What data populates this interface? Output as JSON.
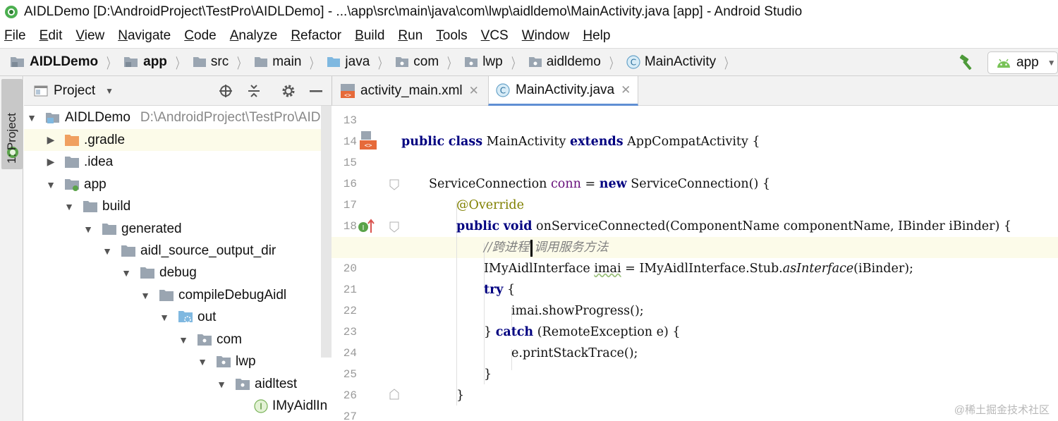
{
  "window": {
    "title": "AIDLDemo [D:\\AndroidProject\\TestPro\\AIDLDemo] - ...\\app\\src\\main\\java\\com\\lwp\\aidldemo\\MainActivity.java [app] - Android Studio"
  },
  "menu": [
    "File",
    "Edit",
    "View",
    "Navigate",
    "Code",
    "Analyze",
    "Refactor",
    "Build",
    "Run",
    "Tools",
    "VCS",
    "Window",
    "Help"
  ],
  "breadcrumb": [
    "AIDLDemo",
    "app",
    "src",
    "main",
    "java",
    "com",
    "lwp",
    "aidldemo",
    "MainActivity"
  ],
  "run_config": "app",
  "tool_window": {
    "label": "1: Project"
  },
  "project_panel": {
    "view": "Project",
    "tree": [
      {
        "label": "AIDLDemo",
        "path": "D:\\AndroidProject\\TestPro\\AIDL"
      },
      {
        "label": ".gradle"
      },
      {
        "label": ".idea"
      },
      {
        "label": "app"
      },
      {
        "label": "build"
      },
      {
        "label": "generated"
      },
      {
        "label": "aidl_source_output_dir"
      },
      {
        "label": "debug"
      },
      {
        "label": "compileDebugAidl"
      },
      {
        "label": "out"
      },
      {
        "label": "com"
      },
      {
        "label": "lwp"
      },
      {
        "label": "aidltest"
      },
      {
        "label": "IMyAidlIn"
      }
    ]
  },
  "tabs": [
    "activity_main.xml",
    "MainActivity.java"
  ],
  "editor": {
    "line_numbers": [
      "13",
      "14",
      "15",
      "16",
      "17",
      "18",
      "19",
      "20",
      "21",
      "22",
      "23",
      "24",
      "25",
      "26",
      "27"
    ]
  },
  "code": {
    "l14": {
      "kw1": "public",
      "kw2": "class",
      "name": "MainActivity",
      "kw3": "extends",
      "rest": "AppCompatActivity {"
    },
    "l16": {
      "type": "ServiceConnection",
      "field": "conn",
      "eq": "=",
      "kw": "new",
      "rest": "ServiceConnection() {"
    },
    "l17": {
      "ann": "@Override"
    },
    "l18": {
      "kw1": "public",
      "kw2": "void",
      "rest": "onServiceConnected(ComponentName componentName, IBinder iBinder) {"
    },
    "l19": {
      "comment_a": "//跨进程",
      "comment_b": "调用服务方法"
    },
    "l20": {
      "a": "IMyAidlInterface ",
      "b": "imai",
      "c": " = IMyAidlInterface.Stub.",
      "d": "asInterface",
      "e": "(iBinder);"
    },
    "l21": {
      "kw": "try",
      "rest": " {"
    },
    "l22": {
      "text": "imai.showProgress();"
    },
    "l23": {
      "a": "} ",
      "kw": "catch",
      "rest": " (RemoteException e) {"
    },
    "l24": {
      "text": "e.printStackTrace();"
    },
    "l25": {
      "text": "}"
    },
    "l26": {
      "text": "}"
    }
  },
  "watermark": "@稀土掘金技术社区"
}
